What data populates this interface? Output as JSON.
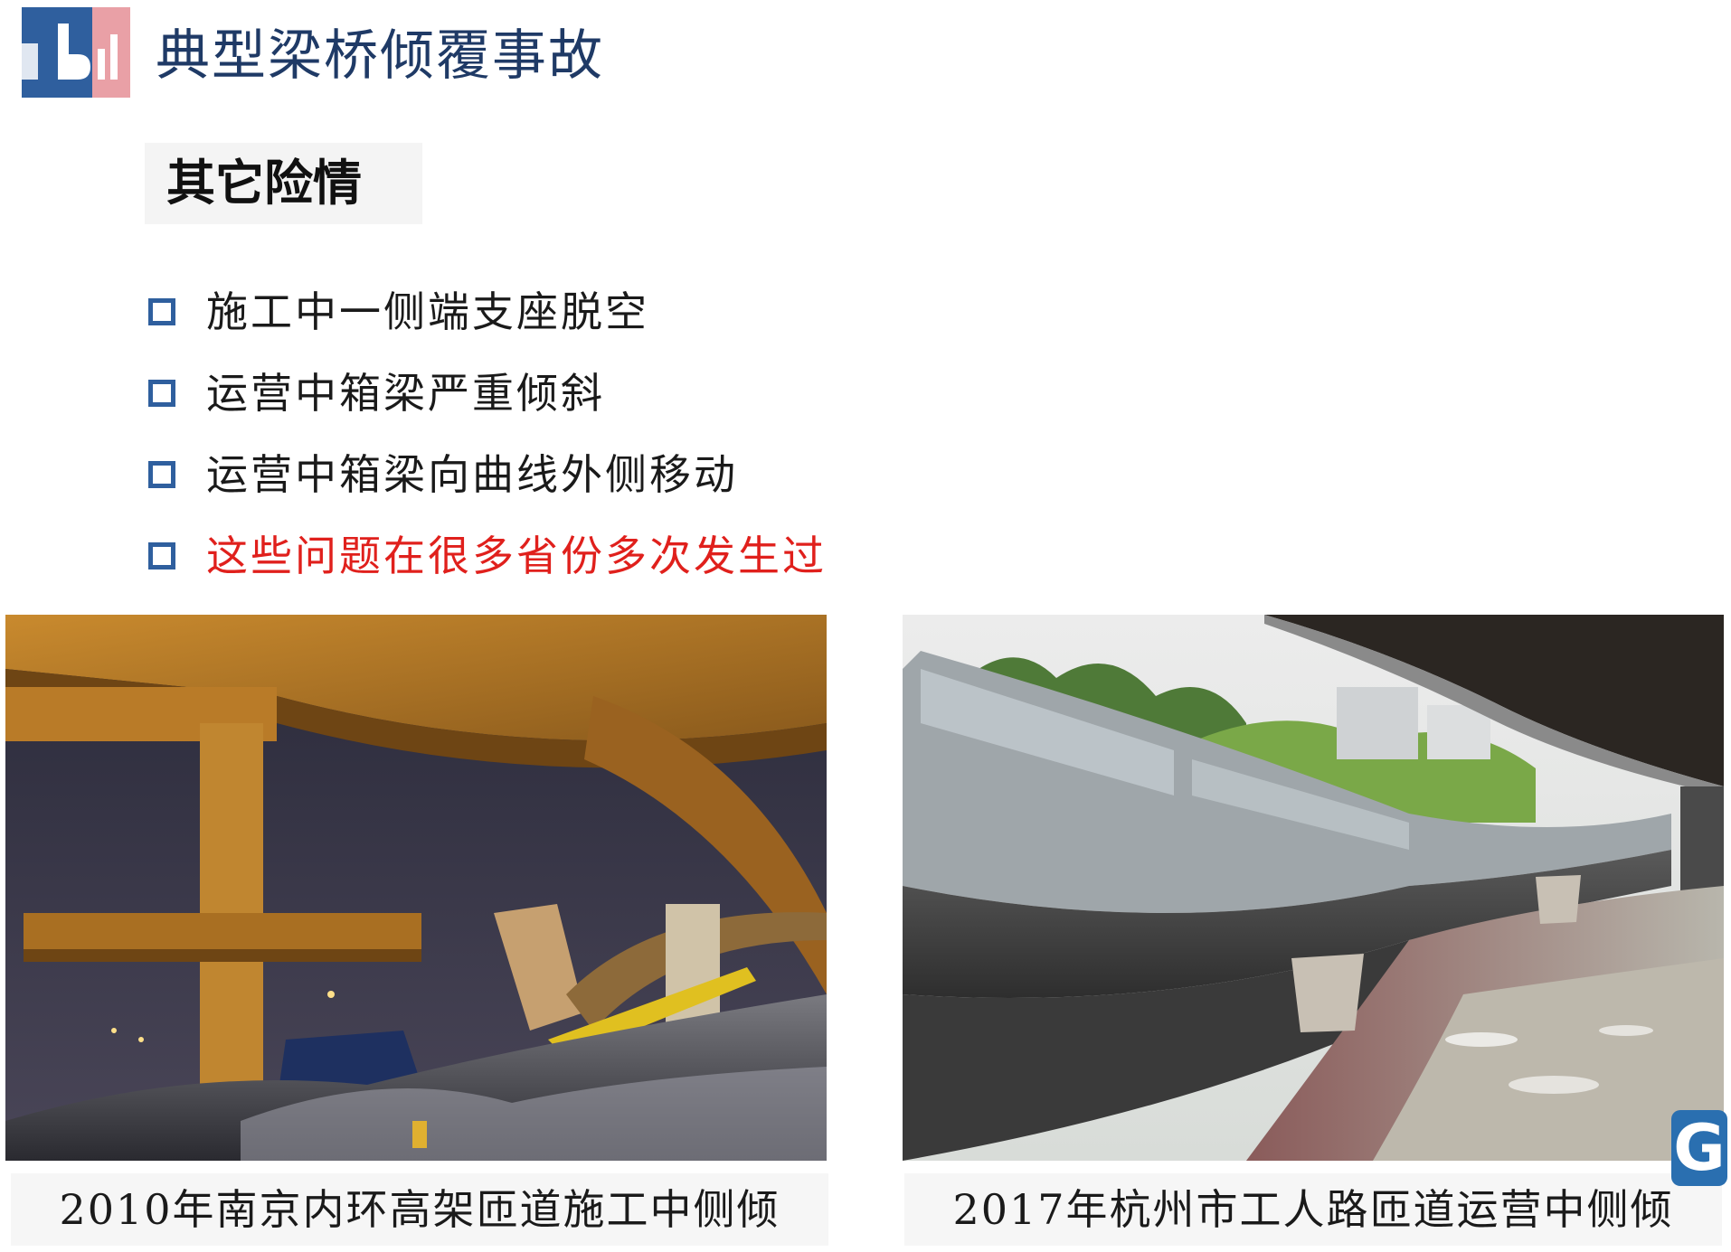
{
  "header": {
    "title": "典型梁桥倾覆事故",
    "logo_icon": "bilibili-logo-icon",
    "accent_color": "#2f5f9e"
  },
  "section": {
    "tag": "其它险情"
  },
  "bullets": [
    {
      "text": "施工中一侧端支座脱空",
      "color": "#1a1a1a"
    },
    {
      "text": "运营中箱梁严重倾斜",
      "color": "#1a1a1a"
    },
    {
      "text": "运营中箱梁向曲线外侧移动",
      "color": "#1a1a1a"
    },
    {
      "text": "这些问题在很多省份多次发生过",
      "color": "#e0201c"
    }
  ],
  "photos": [
    {
      "caption": "2010年南京内环高架匝道施工中侧倾",
      "icon": "night-bridge-collapse-photo"
    },
    {
      "caption": "2017年杭州市工人路匝道运营中侧倾",
      "icon": "tilted-box-girder-photo"
    }
  ],
  "watermark": {
    "letter": "G",
    "icon": "g-watermark-icon"
  }
}
